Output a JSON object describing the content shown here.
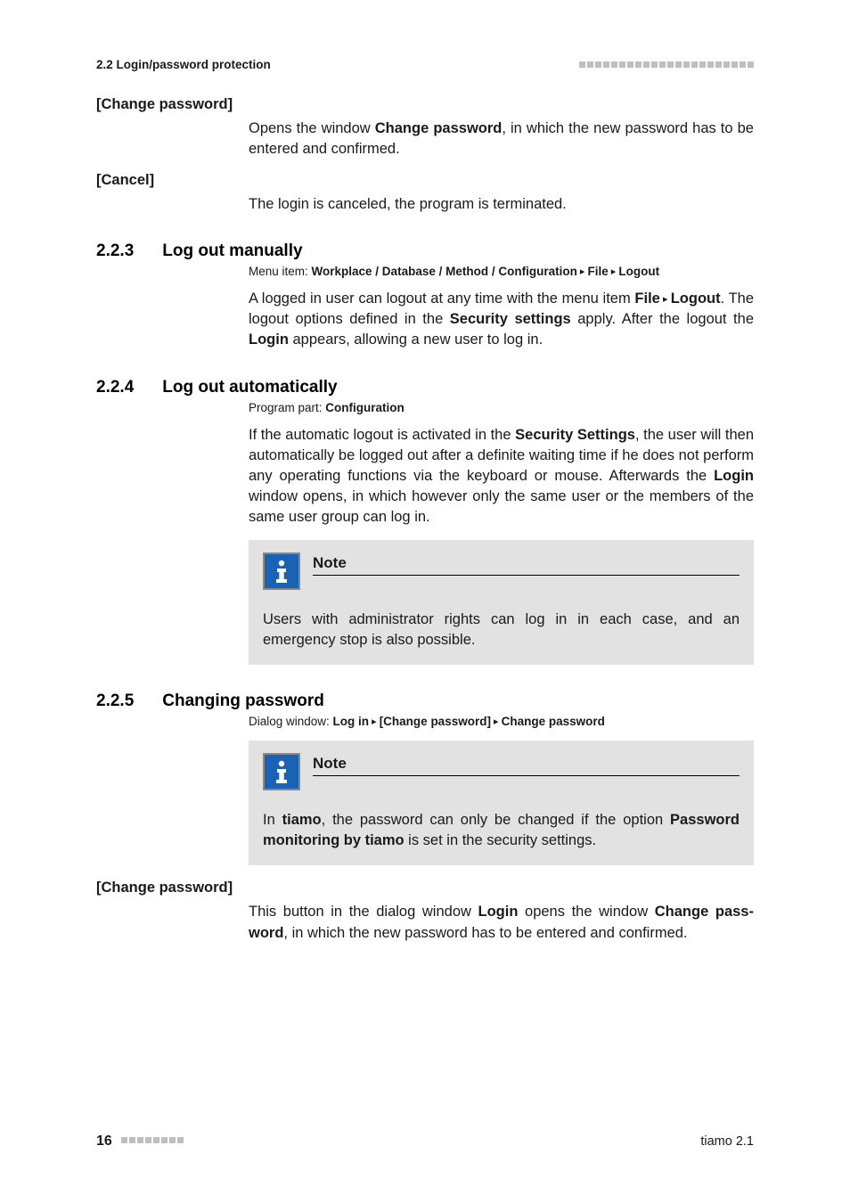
{
  "header": {
    "section": "2.2 Login/password protection",
    "decor_dots": 22
  },
  "terms": {
    "change_pw_1": "[Change password]",
    "change_pw_1_body_pre": "Opens the window ",
    "change_pw_1_body_bold": "Change password",
    "change_pw_1_body_post": ", in which the new password has to be entered and confirmed.",
    "cancel": "[Cancel]",
    "cancel_body": "The login is canceled, the program is terminated."
  },
  "s223": {
    "num": "2.2.3",
    "title": "Log out manually",
    "meta_label": "Menu item: ",
    "meta_bold": "Workplace / Database / Method / Configuration",
    "meta_tri1": " ▸ ",
    "meta_bold2": "File",
    "meta_tri2": " ▸ ",
    "meta_bold3": "Logout",
    "p_pre": "A logged in user can logout at any time with the menu item ",
    "p_b1": "File",
    "p_tri": " ▸ ",
    "p_b2": "Log­out",
    "p_mid": ". The logout options defined in the ",
    "p_b3": "Security settings",
    "p_mid2": " apply. After the logout the ",
    "p_b4": "Login",
    "p_post": " appears, allowing a new user to log in."
  },
  "s224": {
    "num": "2.2.4",
    "title": "Log out automatically",
    "meta_label": "Program part: ",
    "meta_bold": "Configuration",
    "p_pre": "If the automatic logout is activated in the ",
    "p_b1": "Security Settings",
    "p_mid": ", the user will then automatically be logged out after a definite waiting time if he does not perform any operating functions via the keyboard or mouse. Afterwards the ",
    "p_b2": "Login",
    "p_post": " window opens, in which however only the same user or the members of the same user group can log in.",
    "note_title": "Note",
    "note_body": "Users with administrator rights can log in in each case, and an emergency stop is also possible."
  },
  "s225": {
    "num": "2.2.5",
    "title": "Changing password",
    "meta_label": "Dialog window: ",
    "meta_b1": "Log in",
    "meta_tri1": " ▸ ",
    "meta_b2": "[Change password]",
    "meta_tri2": " ▸ ",
    "meta_b3": "Change password",
    "note_title": "Note",
    "note_pre": "In ",
    "note_b1": "tiamo",
    "note_mid": ", the password can only be changed if the option ",
    "note_b2": "Password monitoring by tiamo",
    "note_post": " is set in the security settings.",
    "term": "[Change password]",
    "term_p_pre": "This button in the dialog window ",
    "term_p_b1": "Login",
    "term_p_mid": " opens the window ",
    "term_p_b2": "Change pass­word",
    "term_p_post": ", in which the new password has to be entered and confirmed."
  },
  "footer": {
    "page": "16",
    "decor_dots": 8,
    "product": "tiamo 2.1"
  }
}
